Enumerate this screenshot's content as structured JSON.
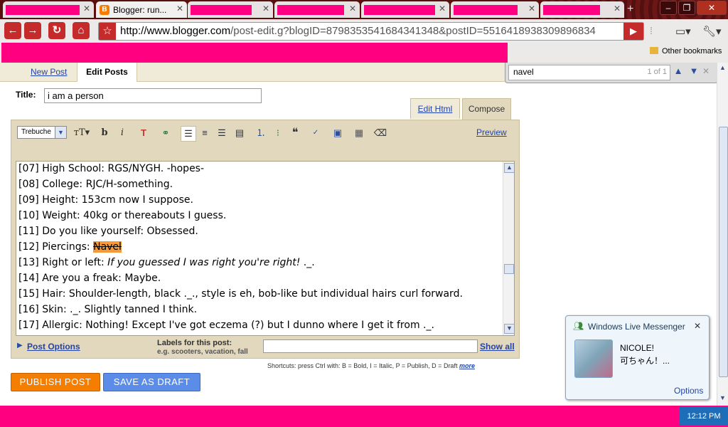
{
  "browser": {
    "active_tab_title": "Blogger: run...",
    "url_domain": "http://www.blogger.com",
    "url_path": "/post-edit.g?blogID=8798353541684341348&postID=5516418938309896834",
    "other_bookmarks": "Other bookmarks"
  },
  "find": {
    "query": "navel",
    "count": "1 of 1"
  },
  "blogger": {
    "tabs": [
      "New Post",
      "Edit Posts"
    ],
    "title_label": "Title:",
    "title_value": "i am a person",
    "edit_html": "Edit Html",
    "compose": "Compose",
    "font_name": "Trebuchet",
    "preview": "Preview",
    "post_options": "Post Options",
    "labels_title": "Labels for this post:",
    "labels_example": "e.g. scooters, vacation, fall",
    "show_all": "Show all",
    "shortcuts": "Shortcuts: press Ctrl with: B = Bold, I = Italic, P = Publish, D = Draft",
    "more": "more",
    "publish": "PUBLISH POST",
    "draft": "SAVE AS DRAFT"
  },
  "content_lines": [
    {
      "id": "07",
      "text": "[07] High School: RGS/NYGH. -hopes-"
    },
    {
      "id": "08",
      "text": "[08] College: RJC/H-something."
    },
    {
      "id": "09",
      "text": "[09] Height: 153cm now I suppose."
    },
    {
      "id": "10",
      "text": "[10] Weight: 40kg or thereabouts I guess."
    },
    {
      "id": "11",
      "text": "[11] Do you like yourself: Obsessed."
    }
  ],
  "line12": {
    "prefix": "[12] Piercings: ",
    "highlight": "Navel"
  },
  "line13": {
    "prefix": "[13] Right or left: ",
    "italic": "If you guessed I was right you're right!",
    "suffix": " ._."
  },
  "content_lines_b": [
    {
      "id": "14",
      "text": "[14] Are you a freak: Maybe."
    },
    {
      "id": "15",
      "text": "[15] Hair: Shoulder-length, black ._., style is eh, bob-like but individual hairs curl forward."
    },
    {
      "id": "16",
      "text": "[16] Skin: ._. Slightly tanned I think."
    },
    {
      "id": "17",
      "text": "[17] Allergic: Nothing! Except I've got eczema (?) but I dunno where I get it from ._."
    }
  ],
  "messenger": {
    "title": "Windows Live Messenger",
    "name": "NICOLE!",
    "message": "可ちゃん！...",
    "options": "Options"
  },
  "clock": "12:12 PM"
}
